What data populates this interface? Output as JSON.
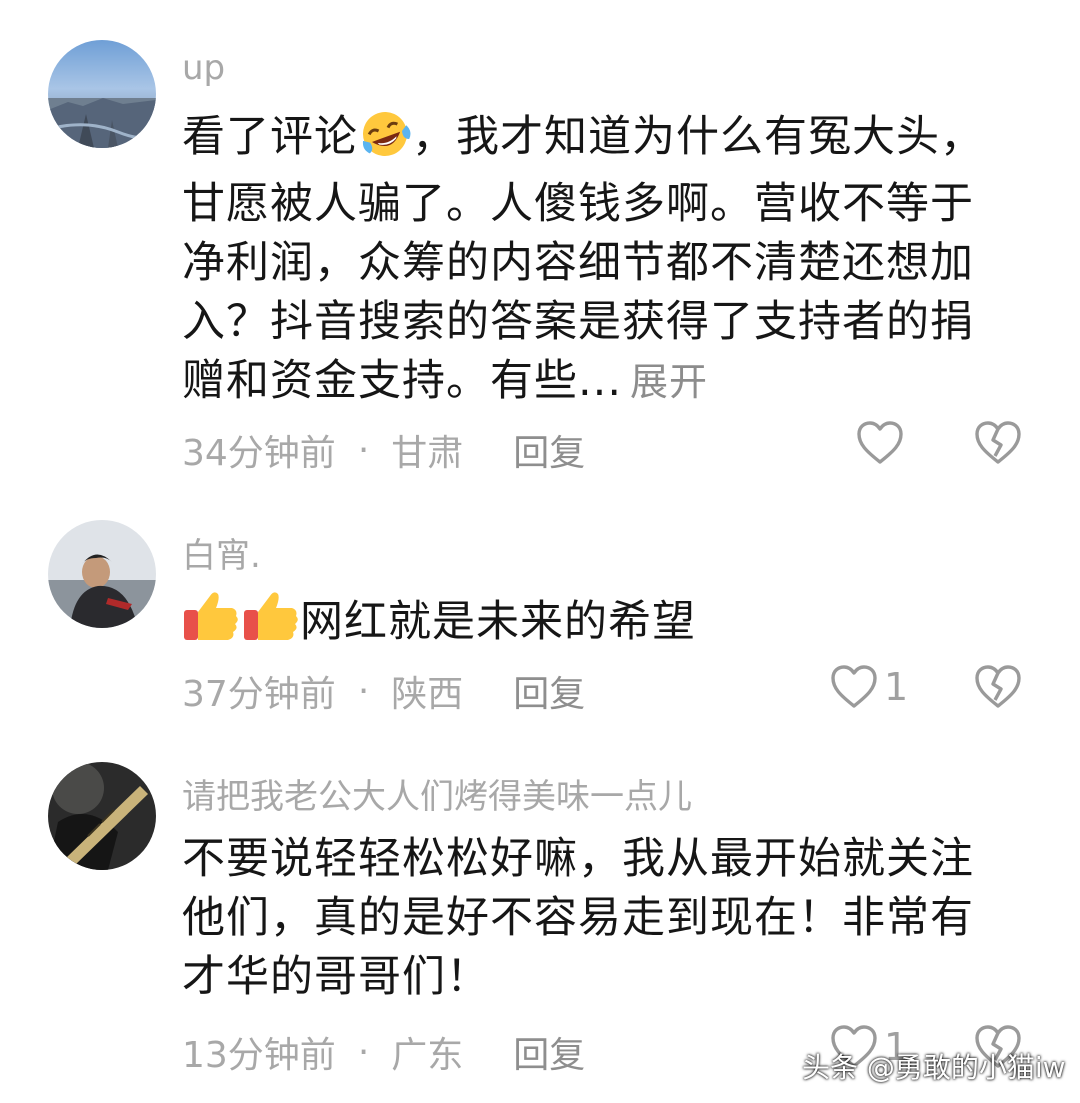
{
  "comments": [
    {
      "username": "up",
      "text_before_emoji": "看了评论",
      "emoji": "laughing-crying-emoji",
      "text_after_emoji": "，我才知道为什么有冤大头，甘愿被人骗了。人傻钱多啊。营收不等于净利润，众筹的内容细节都不清楚还想加入？抖音搜索的答案是获得了支持者的捐赠和资金支持。有些...",
      "expand_label": "展开",
      "time": "34分钟前",
      "separator": "·",
      "location": "甘肃",
      "reply_label": "回复",
      "like_count": ""
    },
    {
      "username": "白宵.",
      "emoji": "thumbs-up-emoji",
      "text": "网红就是未来的希望",
      "time": "37分钟前",
      "separator": "·",
      "location": "陕西",
      "reply_label": "回复",
      "like_count": "1"
    },
    {
      "username": "请把我老公大人们烤得美味一点儿",
      "text": "不要说轻轻松松好嘛，我从最开始就关注他们，真的是好不容易走到现在！非常有才华的哥哥们！",
      "time": "13分钟前",
      "separator": "·",
      "location": "广东",
      "reply_label": "回复",
      "like_count": "1"
    }
  ],
  "watermark": "头条 @勇敢的小猫iw",
  "colors": {
    "meta_gray": "#a8a8a8",
    "text": "#161616",
    "icon_gray": "#9a9a9a"
  }
}
